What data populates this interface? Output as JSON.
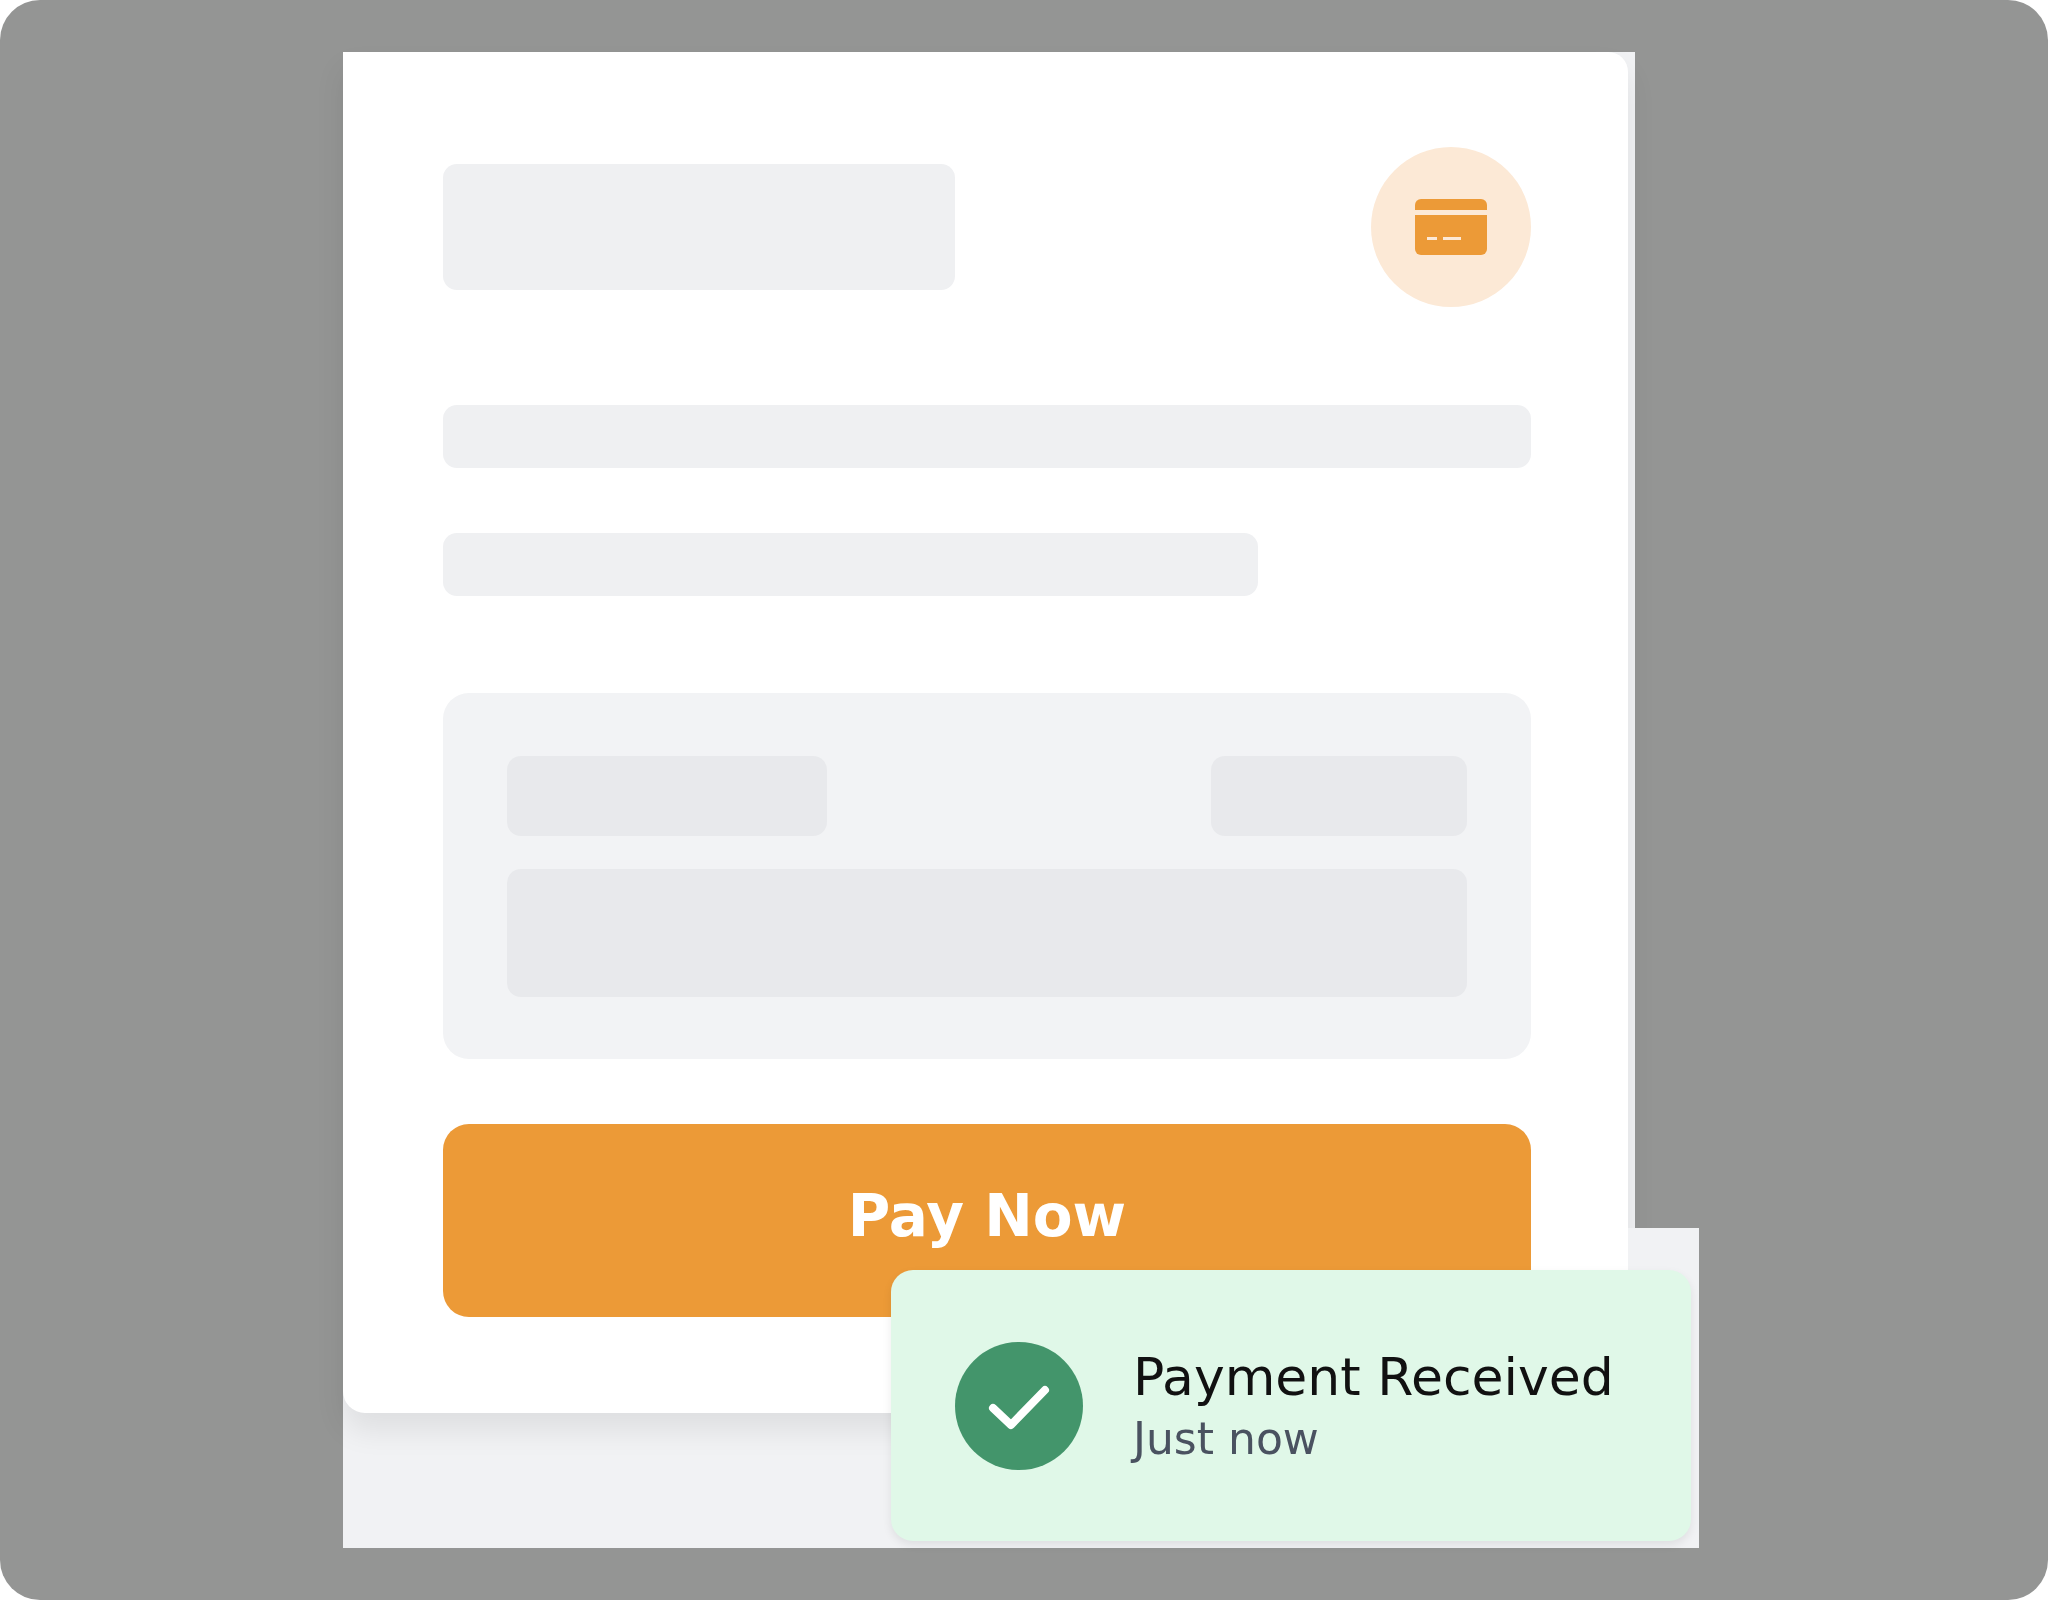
{
  "payment_card": {
    "button": {
      "label": "Pay Now"
    }
  },
  "toast": {
    "kind": "success",
    "title": "Payment Received",
    "time": "Just now"
  }
}
